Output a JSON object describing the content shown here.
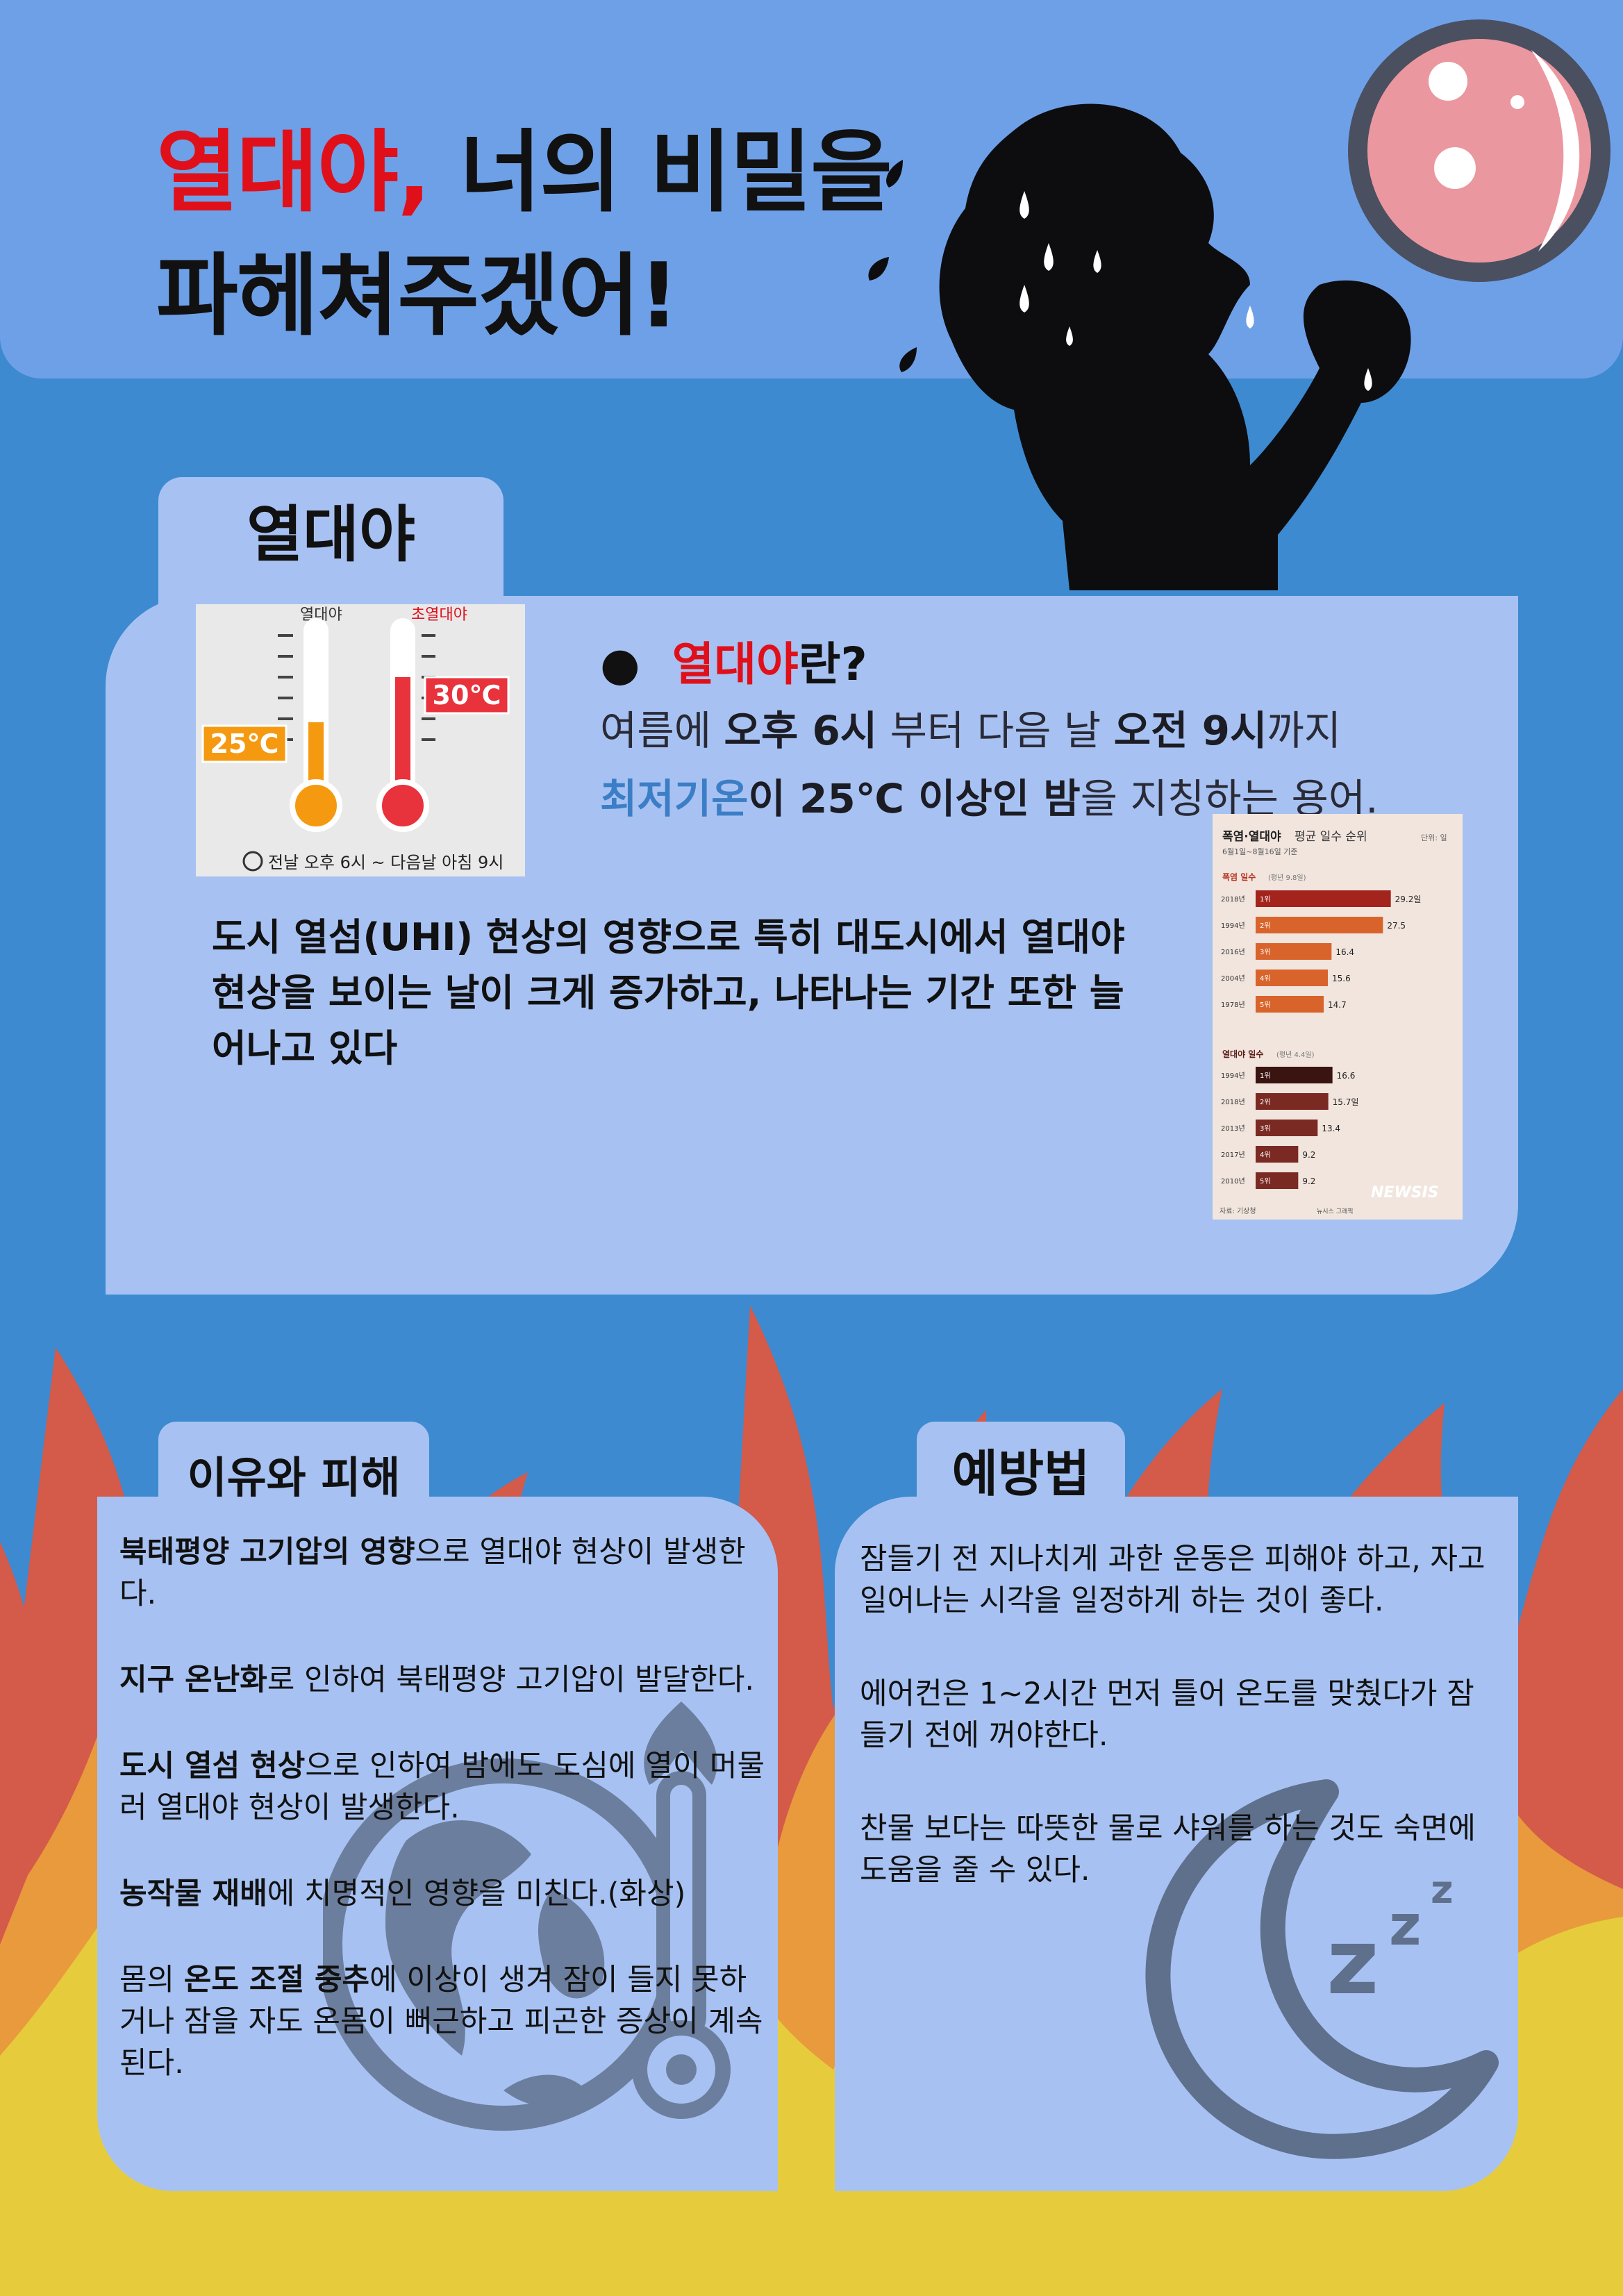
{
  "header": {
    "title_red": "열대야,",
    "title_rest": " 너의 비밀을",
    "title_line2": "파헤쳐주겠어!"
  },
  "info": {
    "tab": "열대야",
    "bullet": "●",
    "heading_red": "열대야",
    "heading_rest": "란?",
    "def_1a": "여름에 ",
    "def_1b": "오후 6시",
    "def_1c": " 부터 다음 날 ",
    "def_1d": "오전 9시",
    "def_1e": "까지",
    "def_2a": "최저기온",
    "def_2b": "이 25℃ 이상인 밤",
    "def_2c": "을 지칭하는 용어.",
    "uhi": "도시 열섬(UHI) 현상의 영향으로 특히 대도시에서 열대야 현상을 보이는 날이 크게 증가하고, 나타나는 기간 또한 늘어나고 있다"
  },
  "thermometer": {
    "left_top": "열대야",
    "right_top": "초열대야",
    "left_value": "25℃",
    "right_value": "30℃",
    "caption": "전날 오후 6시 ~ 다음날 아침 9시"
  },
  "ranking": {
    "title_a": "폭염·열대야",
    "title_b": " 평균 일수 순위",
    "unit": "단위: 일",
    "subtitle": "6월1일~8월16일 기준",
    "group1": "폭염 일수",
    "group1_note": "(평년 9.8일)",
    "group1_rows": [
      {
        "year": "2018년",
        "rank": "1위",
        "value": 29.2,
        "label": "29.2일"
      },
      {
        "year": "1994년",
        "rank": "2위",
        "value": 27.5,
        "label": "27.5"
      },
      {
        "year": "2016년",
        "rank": "3위",
        "value": 16.4,
        "label": "16.4"
      },
      {
        "year": "2004년",
        "rank": "4위",
        "value": 15.6,
        "label": "15.6"
      },
      {
        "year": "1978년",
        "rank": "5위",
        "value": 14.7,
        "label": "14.7"
      }
    ],
    "group2": "열대야 일수",
    "group2_note": "(평년 4.4일)",
    "group2_rows": [
      {
        "year": "1994년",
        "rank": "1위",
        "value": 16.6,
        "label": "16.6"
      },
      {
        "year": "2018년",
        "rank": "2위",
        "value": 15.7,
        "label": "15.7일"
      },
      {
        "year": "2013년",
        "rank": "3위",
        "value": 13.4,
        "label": "13.4"
      },
      {
        "year": "2017년",
        "rank": "4위",
        "value": 9.2,
        "label": "9.2"
      },
      {
        "year": "2010년",
        "rank": "5위",
        "value": 9.2,
        "label": "9.2"
      }
    ],
    "source": "자료: 기상청",
    "credit": "뉴시스 그래픽",
    "brand": "NEWSIS",
    "colors": {
      "group1": "#d8642c",
      "group1_top": "#a3241c",
      "group2": "#7a2a22",
      "group2_top": "#3a1410"
    }
  },
  "reasons": {
    "tab": "이유와 피해",
    "items": [
      {
        "bold": "북태평양 고기압의 영향",
        "rest": "으로 열대야 현상이 발생한다."
      },
      {
        "bold": "지구 온난화",
        "rest": "로 인하여 북태평양 고기압이 발달한다."
      },
      {
        "bold": "도시 열섬 현상",
        "rest": "으로 인하여 밤에도 도심에 열이 머물러 열대야 현상이 발생한다."
      },
      {
        "bold": "농작물 재배",
        "rest": "에 치명적인 영향을 미친다.(화상)"
      },
      {
        "pre": "몸의 ",
        "bold": "온도 조절 중추",
        "rest": "에 이상이 생겨 잠이 들지 못하거나 잠을 자도 온몸이 뻐근하고 피곤한 증상이 계속 된다."
      }
    ]
  },
  "prevention": {
    "tab": "예방법",
    "items": [
      "잠들기 전 지나치게 과한 운동은 피해야 하고, 자고 일어나는 시각을 일정하게 하는 것이 좋다.",
      "에어컨은 1~2시간 먼저 틀어 온도를 맞췄다가 잠들기 전에 꺼야한다.",
      "찬물 보다는 따뜻한 물로 샤워를 하는 것도 숙면에 도움을 줄 수 있다."
    ]
  },
  "colors": {
    "background": "#3d8ad0",
    "header_band": "#6ea0e8",
    "card": "#a7c2f2",
    "accent_red": "#e0101a",
    "flame_red": "#d45a4a",
    "flame_orange": "#e89a3c",
    "flame_yellow": "#e6cc3c"
  },
  "icons": {
    "moon": "full-moon-icon",
    "person": "sweating-person-icon",
    "globe": "globe-thermometer-icon",
    "sleep": "crescent-moon-zzz-icon",
    "alarm": "alarm-clock-icon"
  }
}
